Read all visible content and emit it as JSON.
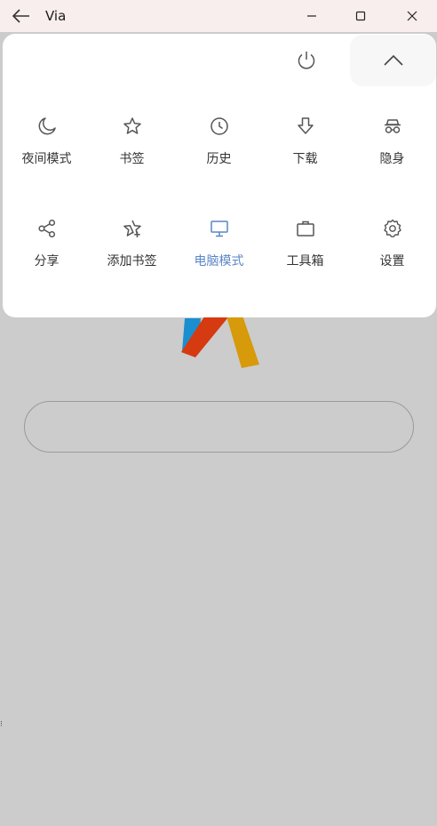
{
  "titlebar": {
    "title": "Via",
    "icons": {
      "back": "arrow-left-icon",
      "minimize": "minimize-icon",
      "maximize": "maximize-icon",
      "close": "close-icon"
    }
  },
  "menu": {
    "top_icons": {
      "power": "power-icon",
      "collapse": "chevron-up-icon"
    },
    "rows": [
      [
        {
          "id": "night-mode",
          "label": "夜间模式",
          "icon": "moon-icon"
        },
        {
          "id": "bookmarks",
          "label": "书签",
          "icon": "star-icon"
        },
        {
          "id": "history",
          "label": "历史",
          "icon": "clock-icon"
        },
        {
          "id": "downloads",
          "label": "下载",
          "icon": "download-icon"
        },
        {
          "id": "incognito",
          "label": "隐身",
          "icon": "incognito-icon"
        }
      ],
      [
        {
          "id": "share",
          "label": "分享",
          "icon": "share-icon"
        },
        {
          "id": "add-bookmark",
          "label": "添加书签",
          "icon": "star-plus-icon"
        },
        {
          "id": "desktop-mode",
          "label": "电脑模式",
          "icon": "monitor-icon",
          "active": true
        },
        {
          "id": "toolbox",
          "label": "工具箱",
          "icon": "briefcase-icon"
        },
        {
          "id": "settings",
          "label": "设置",
          "icon": "gear-icon"
        }
      ]
    ]
  },
  "colors": {
    "titlebar_bg": "#f8eeee",
    "page_bg": "#cccccc",
    "menu_bg": "#ffffff",
    "active": "#5b86c6",
    "icon": "#555555",
    "logo_blue": "#1a8fd0",
    "logo_red": "#d63a10",
    "logo_yellow": "#d69a0a"
  }
}
